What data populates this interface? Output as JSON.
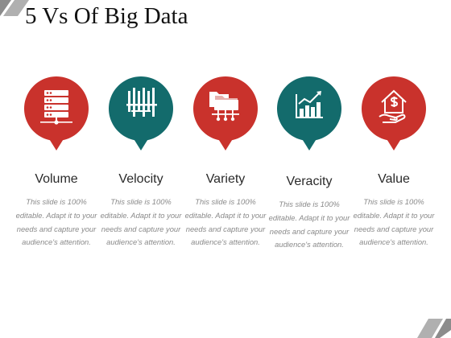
{
  "slide": {
    "title": "5 Vs Of Big Data",
    "colors": {
      "red": "#c9322c",
      "teal": "#136b6c",
      "corner": "#8c8c8c"
    },
    "items": [
      {
        "heading": "Volume",
        "icon": "server-rack-icon",
        "color": "red",
        "description": "This slide is 100% editable. Adapt it to your needs and capture your audience's attention."
      },
      {
        "heading": "Velocity",
        "icon": "speed-bars-icon",
        "color": "teal",
        "description": "This slide is 100% editable. Adapt it to your needs and capture your audience's attention."
      },
      {
        "heading": "Variety",
        "icon": "folders-network-icon",
        "color": "red",
        "description": "This slide is 100% editable. Adapt it to your needs and capture your audience's attention."
      },
      {
        "heading": "Veracity",
        "icon": "bar-chart-icon",
        "color": "teal",
        "description": "This slide is 100% editable. Adapt it to your needs and capture your audience's attention."
      },
      {
        "heading": "Value",
        "icon": "house-dollar-icon",
        "color": "red",
        "description": "This slide is 100% editable. Adapt it to your needs and capture your audience's attention."
      }
    ]
  }
}
